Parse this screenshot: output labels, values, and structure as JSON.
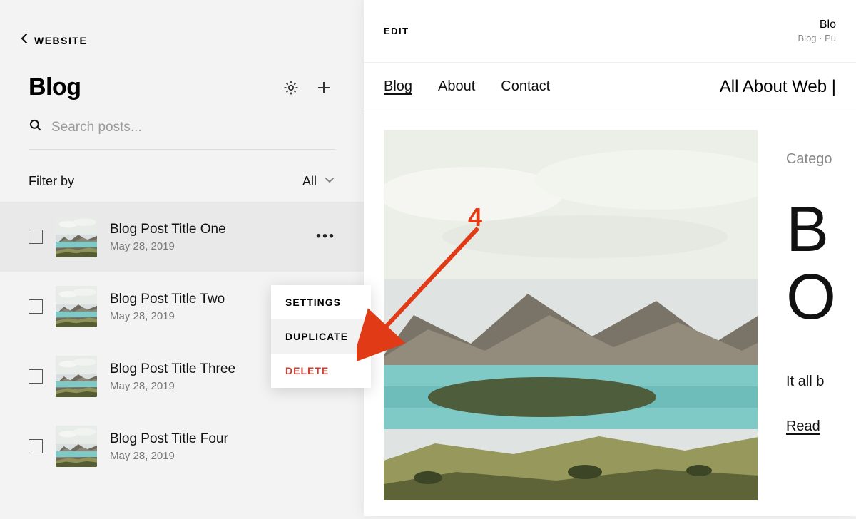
{
  "back_label": "WEBSITE",
  "sidebar": {
    "title": "Blog",
    "search_placeholder": "Search posts...",
    "filter_label": "Filter by",
    "filter_value": "All"
  },
  "posts": [
    {
      "title": "Blog Post Title One",
      "date": "May 28, 2019",
      "selected": true
    },
    {
      "title": "Blog Post Title Two",
      "date": "May 28, 2019",
      "selected": false
    },
    {
      "title": "Blog Post Title Three",
      "date": "May 28, 2019",
      "selected": false
    },
    {
      "title": "Blog Post Title Four",
      "date": "May 28, 2019",
      "selected": false
    }
  ],
  "context_menu": {
    "settings": "SETTINGS",
    "duplicate": "DUPLICATE",
    "delete": "DELETE"
  },
  "preview": {
    "edit_label": "EDIT",
    "header_title": "Blo",
    "header_sub": "Blog · Pu",
    "nav": {
      "blog": "Blog",
      "about": "About",
      "contact": "Contact"
    },
    "site_title": "All About Web |",
    "category_label": "Catego",
    "big_line1": "B",
    "big_line2": "O",
    "lead": "It all b",
    "read": "Read"
  },
  "annotation": {
    "number": "4"
  }
}
